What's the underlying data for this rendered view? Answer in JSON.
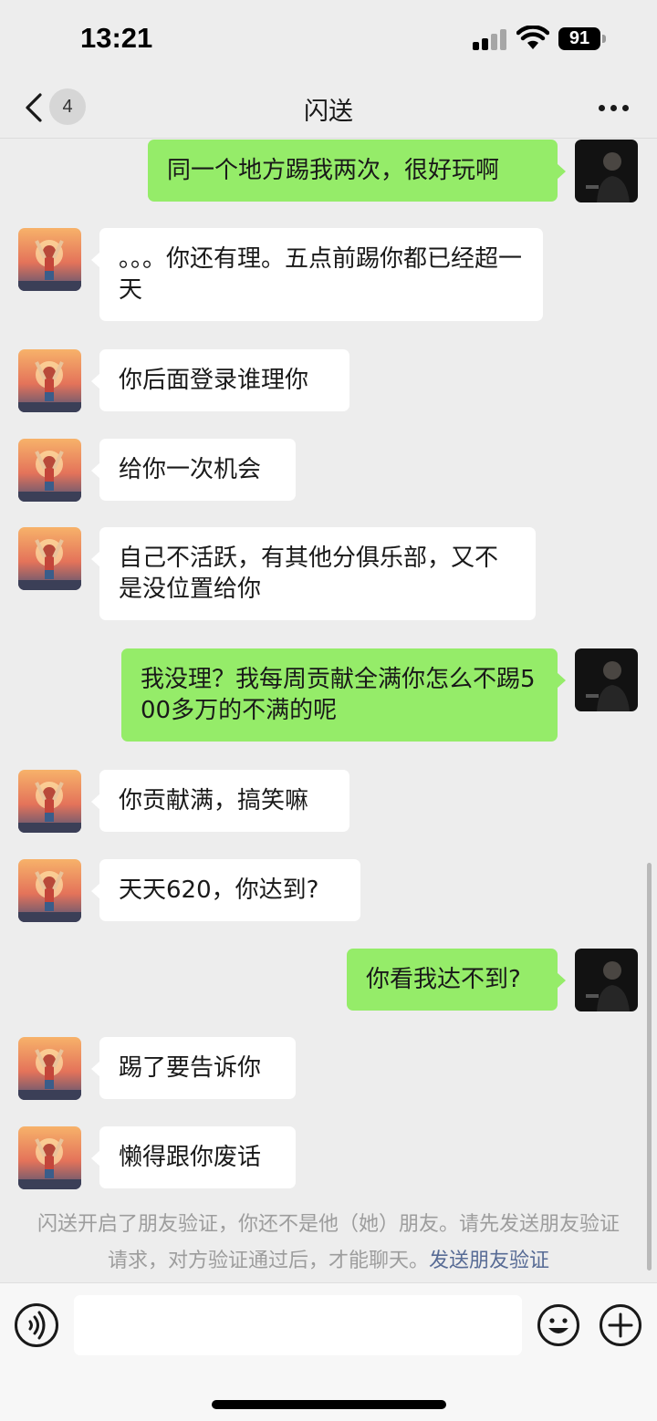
{
  "status_bar": {
    "time": "13:21",
    "battery": "91"
  },
  "nav": {
    "unread_count": "4",
    "title": "闪送"
  },
  "messages": [
    {
      "side": "out",
      "text": "同一个地方踢我两次，很好玩啊"
    },
    {
      "side": "in",
      "text": "。。。你还有理。五点前踢你都已经超一天"
    },
    {
      "side": "in",
      "text": "你后面登录谁理你"
    },
    {
      "side": "in",
      "text": "给你一次机会"
    },
    {
      "side": "in",
      "text": "自己不活跃，有其他分俱乐部，又不是没位置给你"
    },
    {
      "side": "out",
      "text": "我没理？我每周贡献全满你怎么不踢500多万的不满的呢"
    },
    {
      "side": "in",
      "text": "你贡献满，搞笑嘛"
    },
    {
      "side": "in",
      "text": "天天620，你达到?"
    },
    {
      "side": "out",
      "text": "你看我达不到?"
    },
    {
      "side": "in",
      "text": "踢了要告诉你"
    },
    {
      "side": "in",
      "text": "懒得跟你废话"
    }
  ],
  "system_notice": {
    "text": "闪送开启了朋友验证，你还不是他（她）朋友。请先发送朋友验证请求，对方验证通过后，才能聊天。",
    "link": "发送朋友验证"
  },
  "input": {
    "placeholder": ""
  },
  "colors": {
    "background": "#ededed",
    "bubble_out": "#95ec69",
    "bubble_in": "#ffffff",
    "link": "#576b95"
  },
  "icons": [
    "back-arrow-icon",
    "more-icon",
    "voice-icon",
    "emoji-icon",
    "plus-icon",
    "signal-icon",
    "wifi-icon",
    "battery-icon"
  ]
}
